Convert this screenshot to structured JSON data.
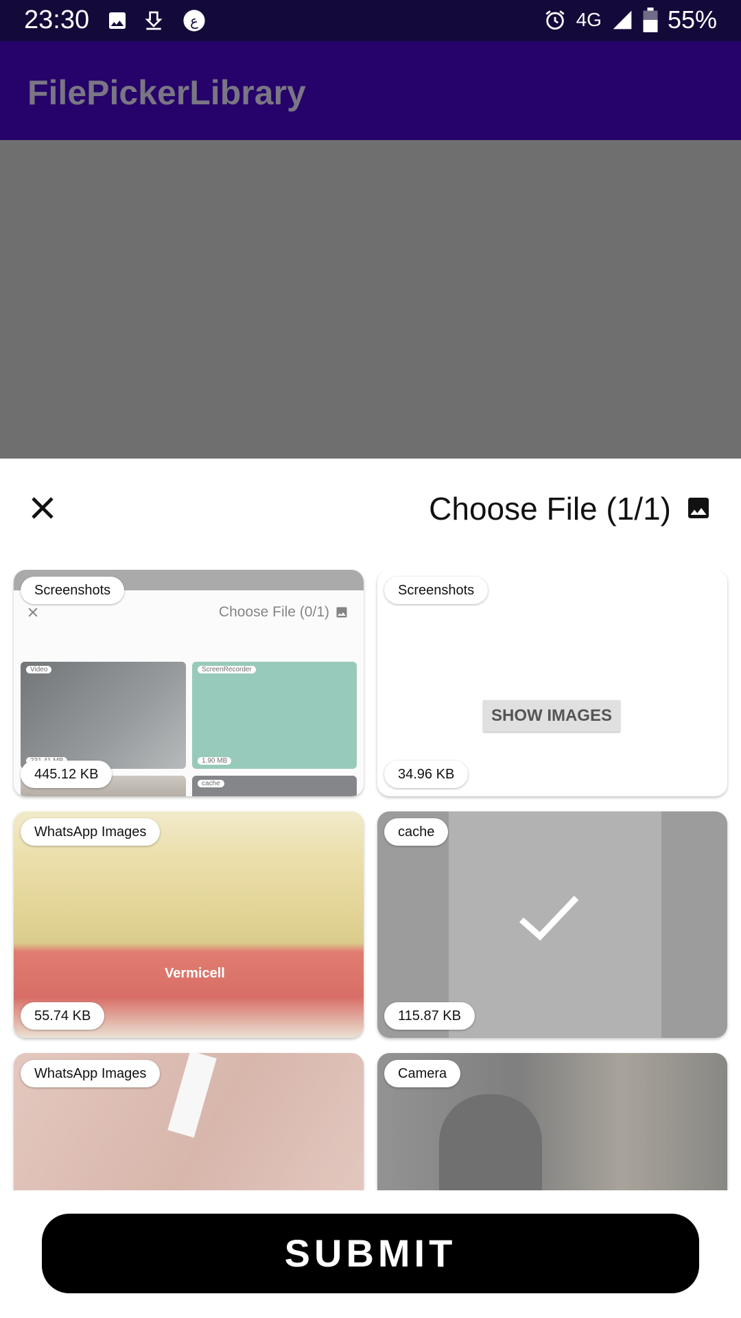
{
  "status_bar": {
    "time": "23:30",
    "network": "4G",
    "battery": "55%",
    "icons_left": [
      "image-icon",
      "download-icon",
      "app-notification-icon"
    ],
    "icons_right": [
      "alarm-icon",
      "signal-icon",
      "battery-icon"
    ]
  },
  "app_bar": {
    "title": "FilePickerLibrary"
  },
  "sheet": {
    "title": "Choose File (1/1)",
    "close_icon": "close-icon",
    "title_icon": "image-icon"
  },
  "items": [
    {
      "folder": "Screenshots",
      "size": "445.12 KB",
      "selected": false,
      "preview": {
        "title": "Choose File (0/1)",
        "labels": [
          "Video",
          "ScreenRecorder",
          "cache"
        ],
        "sizes": [
          "231.41 MB",
          "1.90 MB"
        ]
      }
    },
    {
      "folder": "Screenshots",
      "size": "34.96 KB",
      "selected": false,
      "action": "SHOW IMAGES"
    },
    {
      "folder": "WhatsApp Images",
      "size": "55.74 KB",
      "selected": false,
      "caption": "Vermicell"
    },
    {
      "folder": "cache",
      "size": "115.87 KB",
      "selected": true
    },
    {
      "folder": "WhatsApp Images",
      "size": "",
      "selected": false
    },
    {
      "folder": "Camera",
      "size": "",
      "selected": false
    }
  ],
  "submit_label": "SUBMIT",
  "colors": {
    "status_bar": "#130a3a",
    "app_bar": "#25036a",
    "scrim": "#6f6f6f",
    "accent": "#000000"
  }
}
